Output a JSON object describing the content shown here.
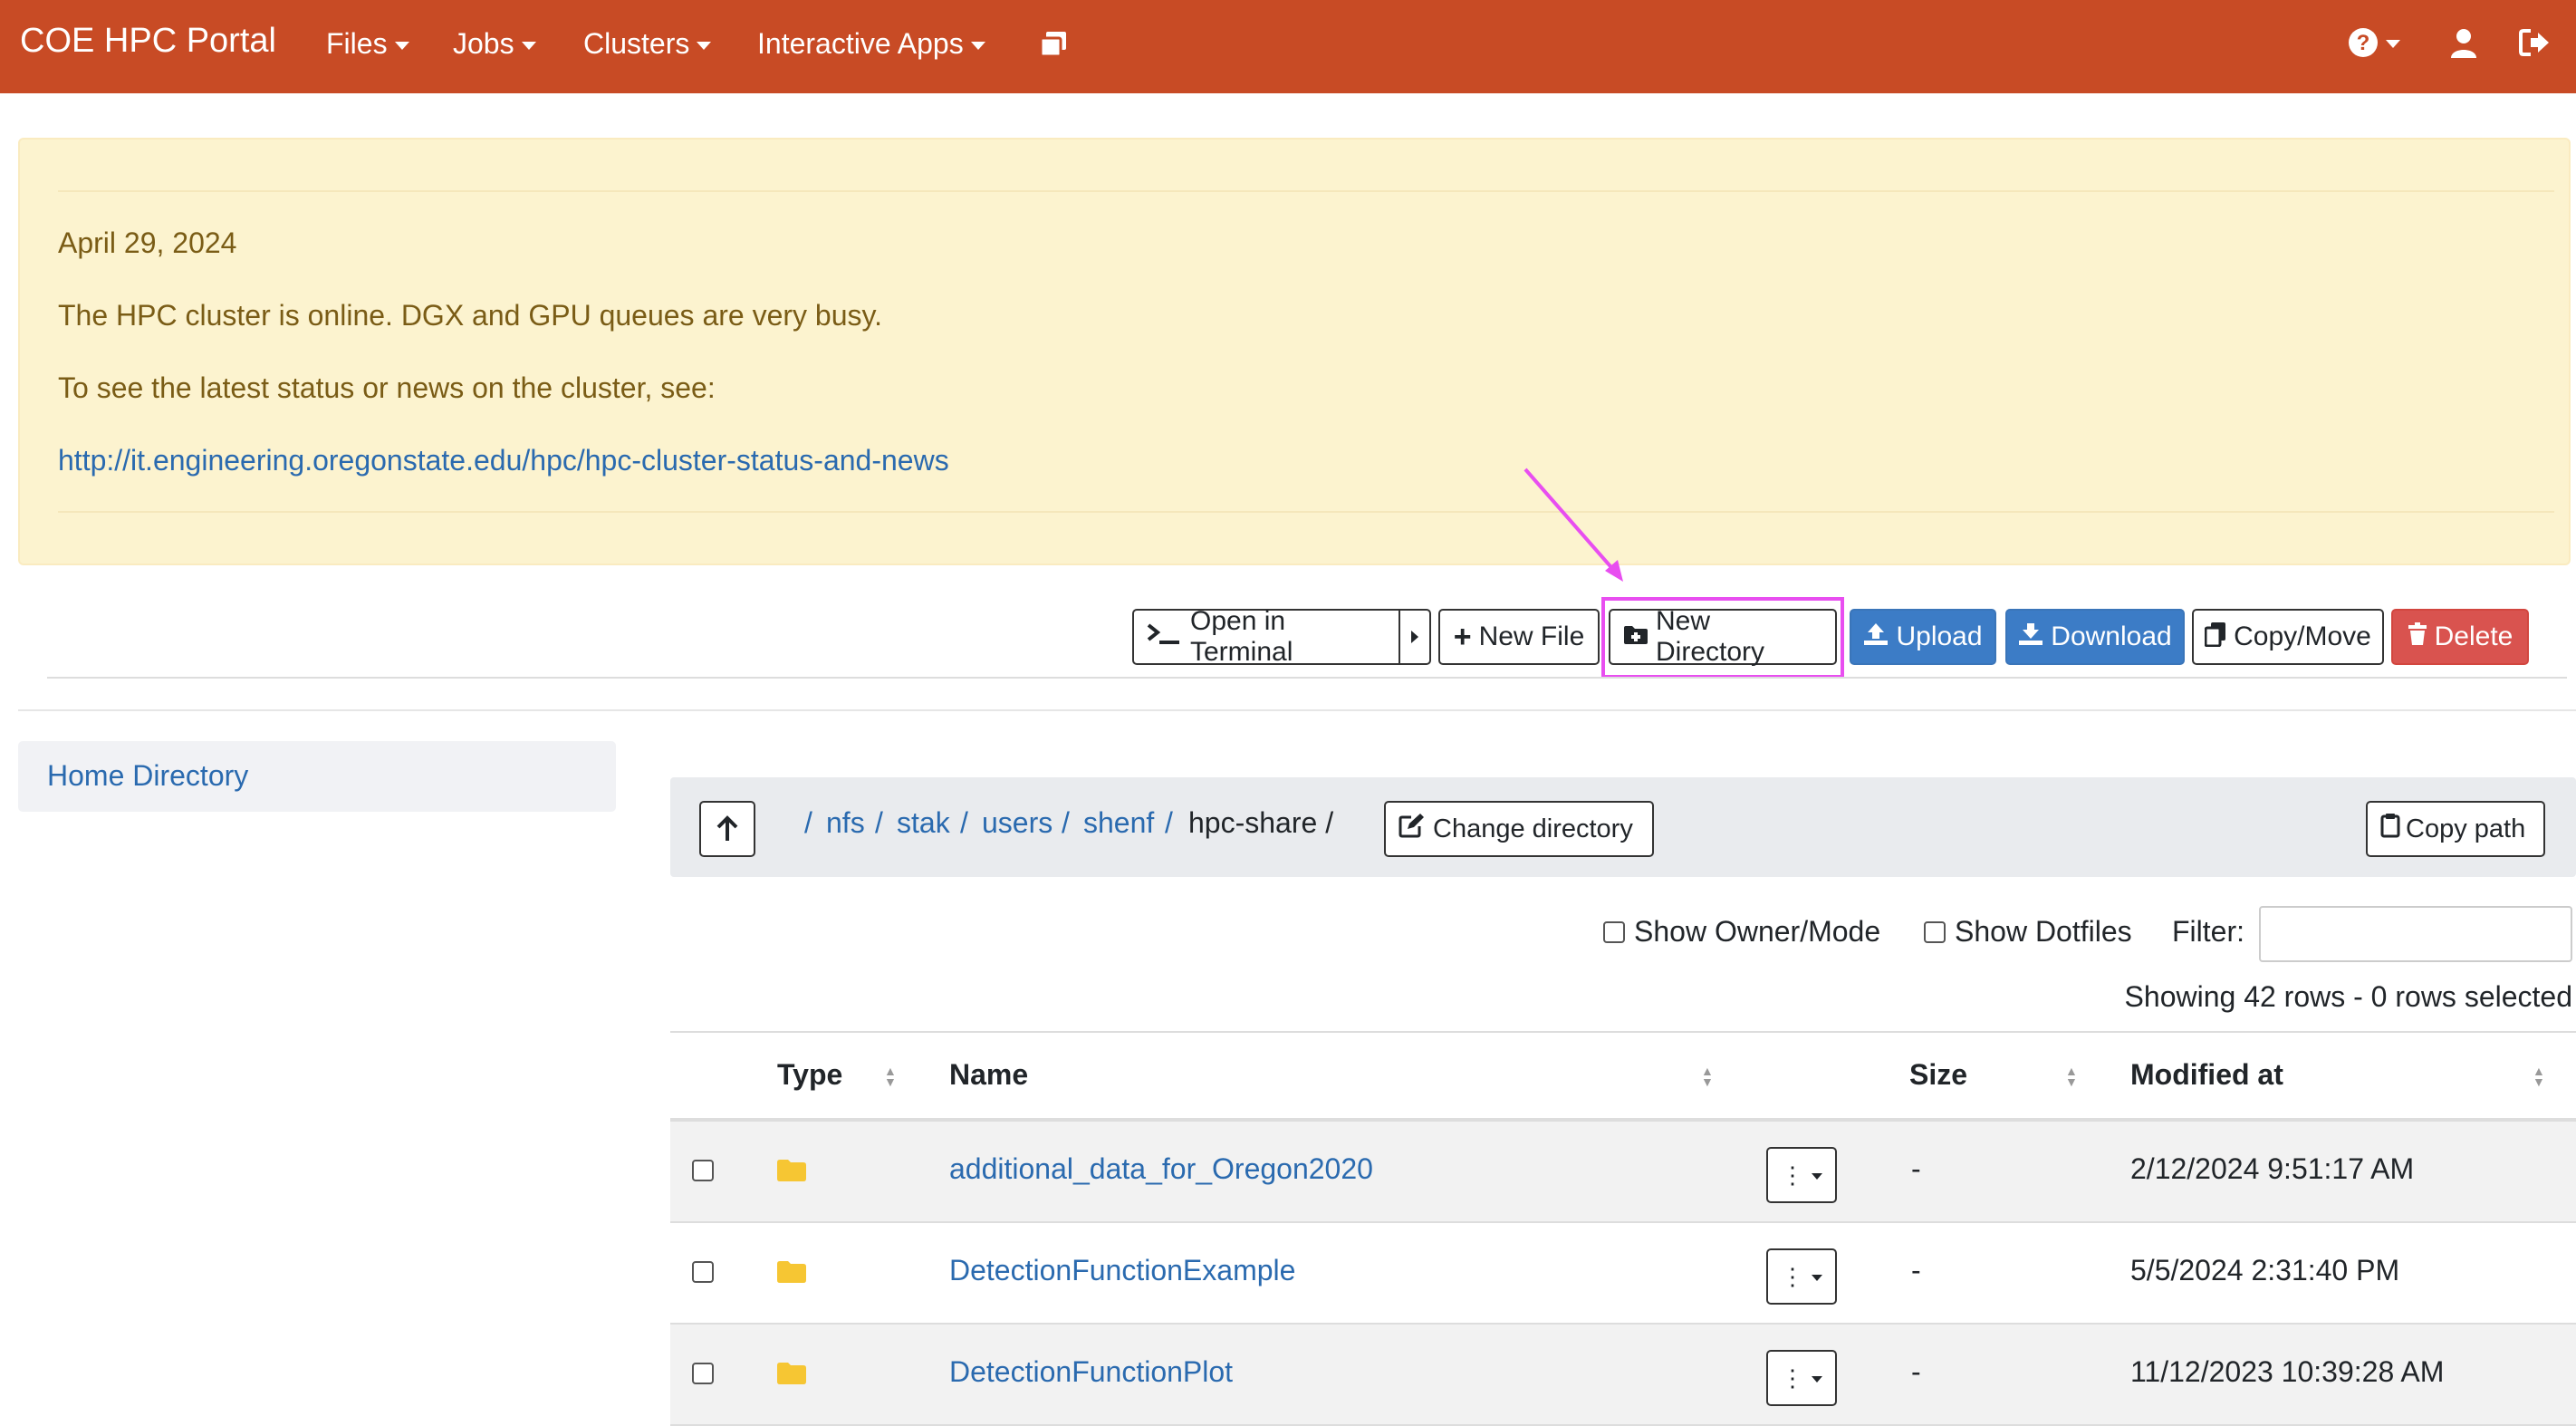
{
  "navbar": {
    "brand": "COE HPC Portal",
    "menus": [
      {
        "label": "Files"
      },
      {
        "label": "Jobs"
      },
      {
        "label": "Clusters"
      },
      {
        "label": "Interactive Apps"
      }
    ],
    "icons": [
      "sessions-icon",
      "help-icon",
      "user-icon",
      "logout-icon"
    ]
  },
  "announcement": {
    "date": "April 29, 2024",
    "line1": "The HPC cluster is online. DGX and GPU queues are very busy.",
    "line2": "To see the latest status or news on the cluster, see:",
    "link": "http://it.engineering.oregonstate.edu/hpc/hpc-cluster-status-and-news"
  },
  "toolbar": {
    "open_terminal": "Open in Terminal",
    "new_file": "New File",
    "new_directory": "New Directory",
    "upload": "Upload",
    "download": "Download",
    "copy_move": "Copy/Move",
    "delete": "Delete"
  },
  "sidebar": {
    "home": "Home Directory"
  },
  "path": {
    "crumbs": [
      "nfs",
      "stak",
      "users",
      "shenf"
    ],
    "current": "hpc-share /",
    "change_directory": "Change directory",
    "copy_path": "Copy path"
  },
  "filters": {
    "show_owner_mode": "Show Owner/Mode",
    "show_dotfiles": "Show Dotfiles",
    "filter_label": "Filter:",
    "rows_info": "Showing 42 rows - 0 rows selected"
  },
  "table": {
    "columns": [
      "Type",
      "Name",
      "Size",
      "Modified at"
    ],
    "rows": [
      {
        "name": "additional_data_for_Oregon2020",
        "size": "-",
        "modified": "2/12/2024 9:51:17 AM"
      },
      {
        "name": "DetectionFunctionExample",
        "size": "-",
        "modified": "5/5/2024 2:31:40 PM"
      },
      {
        "name": "DetectionFunctionPlot",
        "size": "-",
        "modified": "11/12/2023 10:39:28 AM"
      }
    ]
  },
  "colors": {
    "navbar": "#c84b25",
    "alert_bg": "#fcf3cf",
    "link": "#2a6aaf",
    "primary": "#3c7cc6",
    "danger": "#d9534f",
    "highlight": "#e84ef0"
  }
}
